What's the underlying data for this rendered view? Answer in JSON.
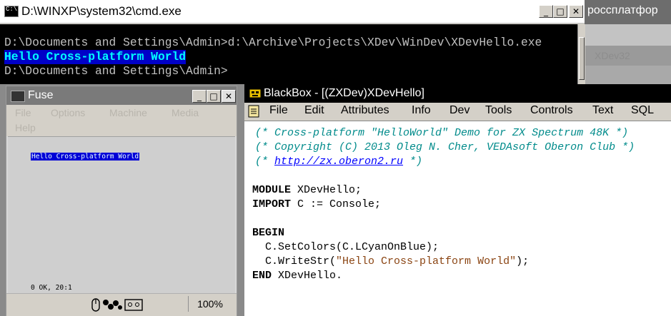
{
  "bg_window": {
    "title": "россплатфор",
    "field_text": "XDev32"
  },
  "cmd": {
    "title": "D:\\WINXP\\system32\\cmd.exe",
    "lines": [
      "D:\\Documents and Settings\\Admin>d:\\Archive\\Projects\\XDev\\WinDev\\XDevHello.exe",
      "Hello Cross-platform World",
      "D:\\Documents and Settings\\Admin>"
    ]
  },
  "fuse": {
    "title": "Fuse",
    "menu": [
      "File",
      "Options",
      "Machine",
      "Media",
      "Help"
    ],
    "screen_text": "Hello Cross-platform World",
    "status_text": "0 OK, 20:1",
    "zoom": "100%"
  },
  "blackbox": {
    "title": "BlackBox - [(ZXDev)XDevHello]",
    "menu": [
      "File",
      "Edit",
      "Attributes",
      "Info",
      "Dev",
      "Tools",
      "Controls",
      "Text",
      "SQL"
    ],
    "code": {
      "c1": "(* Cross-platform \"HelloWorld\" Demo for ZX Spectrum 48K *)",
      "c2": "(* Copyright (C) 2013 Oleg N. Cher, VEDAsoft Oberon Club *)",
      "c3_open": "(* ",
      "c3_link": "http://zx.oberon2.ru",
      "c3_close": " *)",
      "module_kw": "MODULE",
      "module_rest": " XDevHello;",
      "import_kw": "IMPORT",
      "import_rest": " C := Console;",
      "begin_kw": "BEGIN",
      "set_colors": "  C.SetColors(C.LCyanOnBlue);",
      "write_pre": "  C.WriteStr(",
      "write_str": "\"Hello Cross-platform World\"",
      "write_post": ");",
      "end_kw": "END",
      "end_rest": " XDevHello."
    }
  },
  "colors": {
    "cmd_highlight_bg": "#0000c8",
    "cmd_highlight_fg": "#00ffff",
    "comment": "#008b8b",
    "string": "#8b4513",
    "zx_blue": "#0000d7"
  }
}
